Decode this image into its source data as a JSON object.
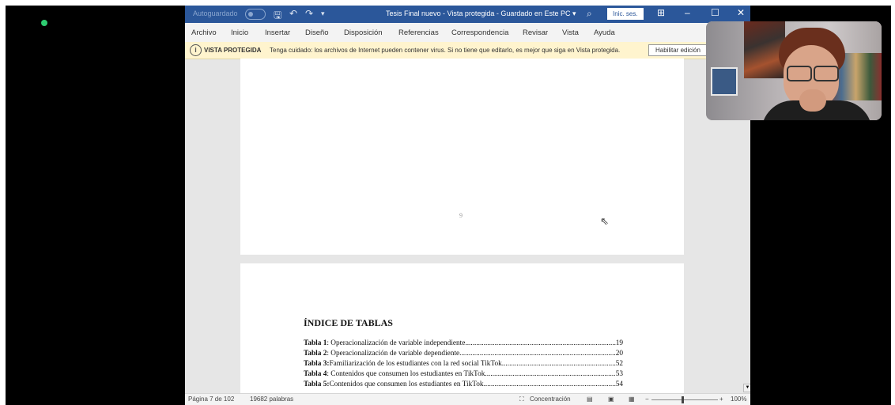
{
  "word": {
    "titlebar": {
      "autosave": "Autoguardado",
      "doc_title": "Tesis Final nuevo  -  Vista protegida  -  Guardado en Este PC  ▾",
      "signin": "Inic. ses."
    },
    "menu": [
      "Archivo",
      "Inicio",
      "Insertar",
      "Diseño",
      "Disposición",
      "Referencias",
      "Correspondencia",
      "Revisar",
      "Vista",
      "Ayuda"
    ],
    "protected_bar": {
      "label": "VISTA PROTEGIDA",
      "message": "Tenga cuidado: los archivos de Internet pueden contener virus. Si no tiene que editarlo, es mejor que siga en Vista protegida.",
      "button": "Habilitar edición"
    },
    "page_number": "9",
    "index": {
      "title": "ÍNDICE DE TABLAS",
      "rows": [
        {
          "label": "Tabla 1",
          "text": ": Operacionalización de variable independiente",
          "page": "19"
        },
        {
          "label": "Tabla 2",
          "text": ": Operacionalización de variable dependiente",
          "page": "20"
        },
        {
          "label": "Tabla 3:",
          "text": " Familiarización de los estudiantes con la red social TikTok",
          "page": "52"
        },
        {
          "label": "Tabla 4",
          "text": ": Contenidos que consumen los estudiantes en TikTok",
          "page": "53"
        },
        {
          "label": "Tabla 5:",
          "text": " Contenidos que consumen los estudiantes en TikTok ",
          "page": "54"
        }
      ]
    },
    "status": {
      "page": "Página 7 de 102",
      "words": "19682 palabras",
      "focus": "Concentración",
      "zoom": "100%"
    }
  },
  "colors": {
    "title_bar": "#2b579a",
    "warning_bar": "#fff4ce",
    "indicator": "#2ecc71"
  },
  "icons": [
    "save-icon",
    "undo-icon",
    "redo-icon",
    "search-icon",
    "ribbon-display-icon",
    "minimize-icon",
    "maximize-icon",
    "close-icon",
    "shield-info-icon",
    "mouse-cursor-icon"
  ]
}
